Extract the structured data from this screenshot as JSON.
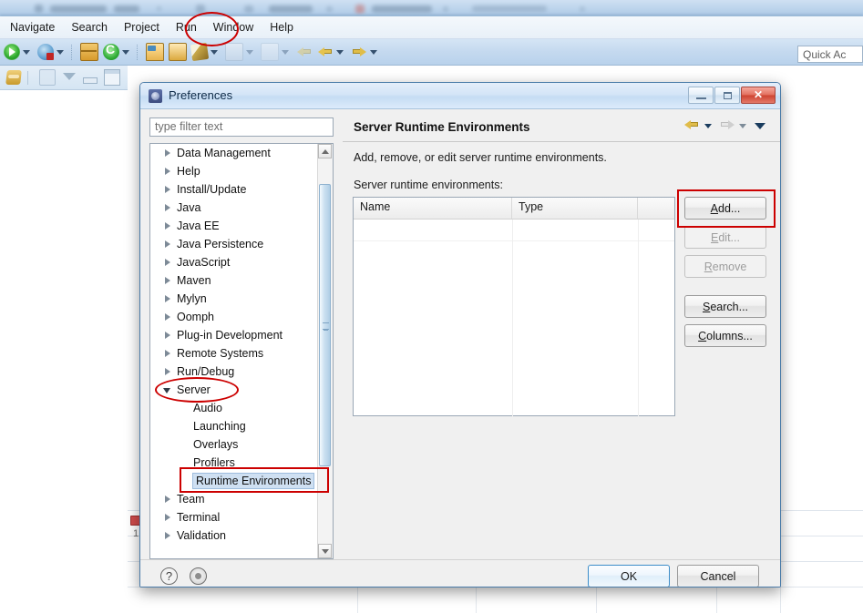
{
  "app": {
    "menu_items": [
      "Navigate",
      "Search",
      "Project",
      "Run",
      "Window",
      "Help"
    ],
    "quick_access_value": "Quick Ac",
    "toolbar_icons": [
      "run-icon",
      "run-dropdown-icon",
      "debug-icon",
      "debug-dropdown-icon",
      "new-wizard-icon",
      "refresh-icon",
      "refresh-dropdown-icon",
      "open-type-icon",
      "open-resource-icon",
      "build-icon",
      "build-dropdown-icon",
      "external-tools-icon",
      "external-tools-dropdown-icon",
      "deploy-icon",
      "back-icon",
      "back-dropdown-icon",
      "forward-icon",
      "forward-dropdown-icon"
    ],
    "view_toolbar_icons": [
      "link-with-editor-icon",
      "collapse-all-icon",
      "filter-icon",
      "minimize-icon",
      "maximize-icon"
    ],
    "editor_gutter_line_number": "1"
  },
  "dialog": {
    "title": "Preferences",
    "title_icon": "preferences-icon",
    "window_buttons": [
      {
        "name": "minimize-button",
        "icon": "minimize-icon"
      },
      {
        "name": "maximize-button",
        "icon": "maximize-icon"
      },
      {
        "name": "close-button",
        "icon": "close-icon"
      }
    ],
    "filter_placeholder": "type filter text",
    "filter_value": "",
    "tree": [
      {
        "label": "Data Management",
        "expandable": true,
        "expanded": false,
        "level": 0
      },
      {
        "label": "Help",
        "expandable": true,
        "expanded": false,
        "level": 0
      },
      {
        "label": "Install/Update",
        "expandable": true,
        "expanded": false,
        "level": 0
      },
      {
        "label": "Java",
        "expandable": true,
        "expanded": false,
        "level": 0
      },
      {
        "label": "Java EE",
        "expandable": true,
        "expanded": false,
        "level": 0
      },
      {
        "label": "Java Persistence",
        "expandable": true,
        "expanded": false,
        "level": 0
      },
      {
        "label": "JavaScript",
        "expandable": true,
        "expanded": false,
        "level": 0
      },
      {
        "label": "Maven",
        "expandable": true,
        "expanded": false,
        "level": 0
      },
      {
        "label": "Mylyn",
        "expandable": true,
        "expanded": false,
        "level": 0
      },
      {
        "label": "Oomph",
        "expandable": true,
        "expanded": false,
        "level": 0
      },
      {
        "label": "Plug-in Development",
        "expandable": true,
        "expanded": false,
        "level": 0
      },
      {
        "label": "Remote Systems",
        "expandable": true,
        "expanded": false,
        "level": 0
      },
      {
        "label": "Run/Debug",
        "expandable": true,
        "expanded": false,
        "level": 0
      },
      {
        "label": "Server",
        "expandable": true,
        "expanded": true,
        "level": 0
      },
      {
        "label": "Audio",
        "expandable": false,
        "expanded": false,
        "level": 1
      },
      {
        "label": "Launching",
        "expandable": false,
        "expanded": false,
        "level": 1
      },
      {
        "label": "Overlays",
        "expandable": false,
        "expanded": false,
        "level": 1
      },
      {
        "label": "Profilers",
        "expandable": false,
        "expanded": false,
        "level": 1
      },
      {
        "label": "Runtime Environments",
        "expandable": false,
        "expanded": false,
        "level": 1,
        "selected": true
      },
      {
        "label": "Team",
        "expandable": true,
        "expanded": false,
        "level": 0
      },
      {
        "label": "Terminal",
        "expandable": true,
        "expanded": false,
        "level": 0
      },
      {
        "label": "Validation",
        "expandable": true,
        "expanded": false,
        "level": 0
      }
    ],
    "page": {
      "title": "Server Runtime Environments",
      "description": "Add, remove, or edit server runtime environments.",
      "list_label": "Server runtime environments:",
      "nav_icons": [
        "back-arrow-icon",
        "back-dropdown-icon",
        "forward-arrow-icon",
        "forward-dropdown-icon",
        "view-menu-icon"
      ],
      "table": {
        "columns": [
          "Name",
          "Type",
          ""
        ],
        "rows": []
      },
      "buttons": [
        {
          "label": "Add...",
          "name": "add-button",
          "enabled": true,
          "mnemonic": "A"
        },
        {
          "label": "Edit...",
          "name": "edit-button",
          "enabled": false,
          "mnemonic": "E"
        },
        {
          "label": "Remove",
          "name": "remove-button",
          "enabled": false,
          "mnemonic": "R"
        },
        {
          "label": "Search...",
          "name": "search-button",
          "enabled": true,
          "mnemonic": "S"
        },
        {
          "label": "Columns...",
          "name": "columns-button",
          "enabled": true,
          "mnemonic": "C"
        }
      ]
    },
    "footer": {
      "help_icon": "help-icon",
      "help_glyph": "?",
      "apply_icon": "apply-icon",
      "ok_label": "OK",
      "cancel_label": "Cancel"
    }
  },
  "annotations": {
    "color": "#cc0000",
    "shapes": [
      {
        "name": "annotation-ellipse-window-menu",
        "type": "ellipse",
        "target": "Window"
      },
      {
        "name": "annotation-ellipse-server-node",
        "type": "ellipse",
        "target": "Server"
      },
      {
        "name": "annotation-rect-runtime-environments",
        "type": "rect",
        "target": "Runtime Environments"
      },
      {
        "name": "annotation-rect-add-button",
        "type": "rect",
        "target": "Add..."
      }
    ]
  }
}
